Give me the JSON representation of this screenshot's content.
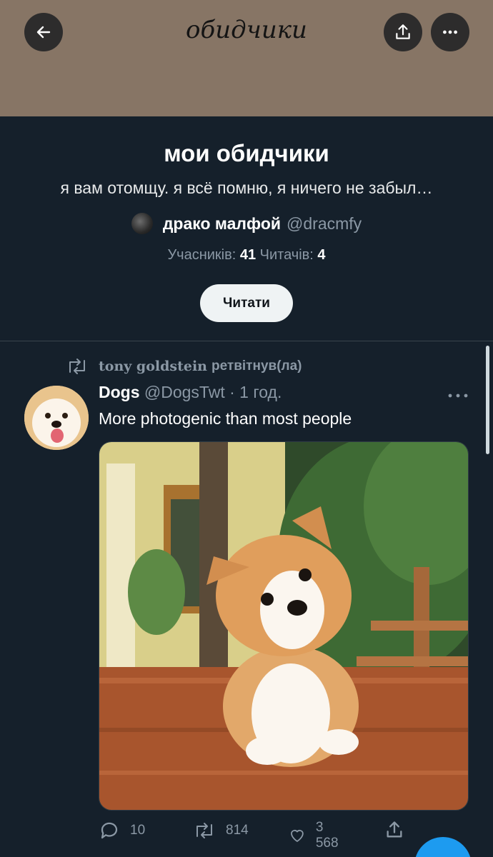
{
  "header": {
    "banner_title": "обидчики",
    "back_icon": "arrow-left-icon",
    "share_icon": "share-icon",
    "more_icon": "more-horizontal-icon"
  },
  "list": {
    "name": "мои обидчики",
    "description": "я вам отомщу. я всё помню, я ничего не забыл…",
    "owner_name": "драко малфой",
    "owner_handle": "@dracmfy",
    "members_label": "Учасників:",
    "members_count": "41",
    "followers_label": "Читачів:",
    "followers_count": "4",
    "follow_button": "Читати"
  },
  "tweet": {
    "retweeter": "tony goldstein",
    "retweet_suffix": "ретвітнув(ла)",
    "author": "Dogs",
    "handle": "@DogsTwt",
    "separator": "·",
    "time": "1 год.",
    "text": "More photogenic than most people",
    "replies": "10",
    "retweets": "814",
    "likes": "3 568"
  },
  "colors": {
    "background": "#15202b",
    "banner": "#877565",
    "secondary_text": "#8b98a5",
    "accent": "#1d9bf0"
  }
}
